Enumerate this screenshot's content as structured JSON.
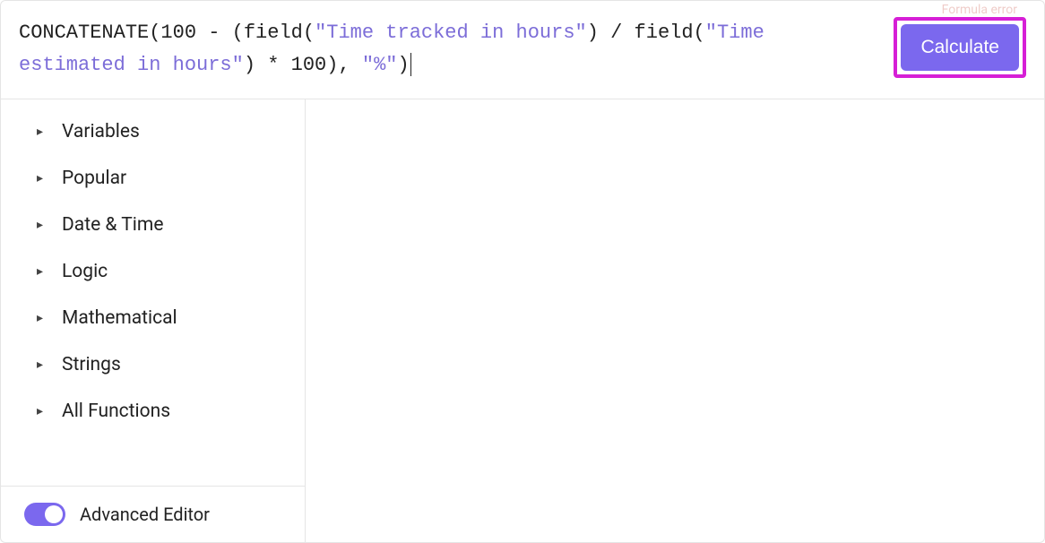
{
  "error_hint": "Formula error",
  "formula": {
    "parts": [
      {
        "t": "fn",
        "v": "CONCATENATE"
      },
      {
        "t": "p",
        "v": "(100 - (field("
      },
      {
        "t": "str",
        "v": "\"Time tracked in hours\""
      },
      {
        "t": "p",
        "v": ") / field("
      },
      {
        "t": "str",
        "v": "\"Time estimated in hours\""
      },
      {
        "t": "p",
        "v": ") * 100), "
      },
      {
        "t": "str",
        "v": "\"%\""
      },
      {
        "t": "p",
        "v": ")"
      }
    ]
  },
  "calculate_label": "Calculate",
  "sidebar": {
    "categories": [
      {
        "label": "Variables"
      },
      {
        "label": "Popular"
      },
      {
        "label": "Date & Time"
      },
      {
        "label": "Logic"
      },
      {
        "label": "Mathematical"
      },
      {
        "label": "Strings"
      },
      {
        "label": "All Functions"
      }
    ],
    "advanced_editor_label": "Advanced Editor",
    "advanced_editor_on": true
  }
}
